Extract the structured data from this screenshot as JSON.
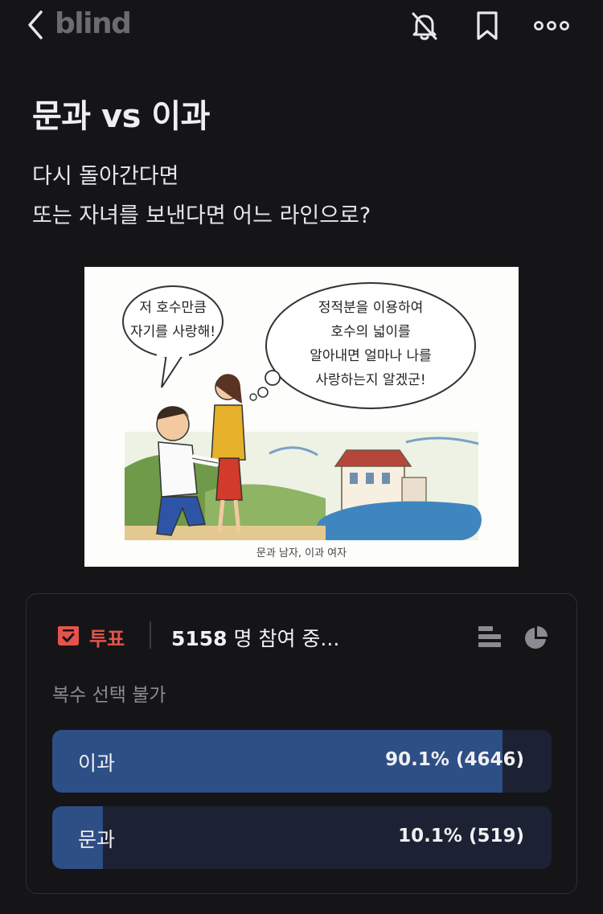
{
  "header": {
    "logo": "blind",
    "icons": [
      "chevron-left-icon",
      "bell-off-icon",
      "bookmark-icon",
      "more-icon"
    ]
  },
  "post": {
    "title": "문과 vs 이과",
    "body_lines": [
      "다시 돌아간다면",
      "또는 자녀를 보낸다면 어느 라인으로?"
    ]
  },
  "cartoon": {
    "bubble_left": [
      "저 호수만큼",
      "자기를 사랑해!"
    ],
    "bubble_right": [
      "정적분을 이용하여",
      "호수의 넓이를",
      "알아내면 얼마나 나를",
      "사랑하는지 알겠군!"
    ],
    "caption": "문과 남자, 이과 여자"
  },
  "poll": {
    "label": "투표",
    "participants_count": "5158",
    "participants_suffix": " 명 참여 중...",
    "multi_select": "복수 선택 불가",
    "options": [
      {
        "label": "이과",
        "result": "90.1% (4646)",
        "percent": 90.1
      },
      {
        "label": "문과",
        "result": "10.1% (519)",
        "percent": 10.1
      }
    ],
    "colors": {
      "accent": "#e5534b",
      "bar_fill": "#2e4e86",
      "bar_bg": "#1c2233"
    }
  }
}
